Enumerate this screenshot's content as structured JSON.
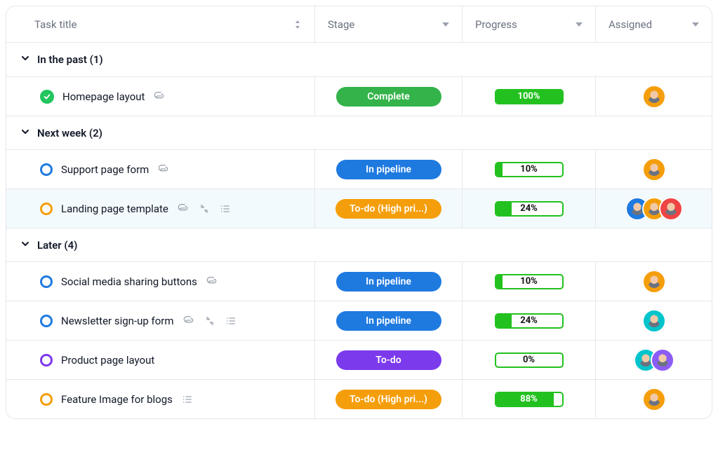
{
  "columns": {
    "title": "Task title",
    "stage": "Stage",
    "progress": "Progress",
    "assigned": "Assigned"
  },
  "groups": [
    {
      "label": "In the past (1)",
      "tasks": [
        {
          "status_type": "check",
          "status_color": "green",
          "name": "Homepage layout",
          "icons": [
            "attachment"
          ],
          "stage_label": "Complete",
          "stage_color": "green",
          "progress_pct": 100,
          "progress_text": "100%",
          "avatars": [
            {
              "bg": "orange"
            }
          ],
          "highlight": false
        }
      ]
    },
    {
      "label": "Next week (2)",
      "tasks": [
        {
          "status_type": "circle",
          "status_color": "blue",
          "name": "Support page form",
          "icons": [
            "attachment"
          ],
          "stage_label": "In pipeline",
          "stage_color": "blue",
          "progress_pct": 10,
          "progress_text": "10%",
          "avatars": [
            {
              "bg": "orange"
            }
          ],
          "highlight": false
        },
        {
          "status_type": "circle",
          "status_color": "orange",
          "name": "Landing page template",
          "icons": [
            "attachment",
            "subtask",
            "list"
          ],
          "stage_label": "To-do (High pri...)",
          "stage_color": "orange",
          "progress_pct": 24,
          "progress_text": "24%",
          "avatars": [
            {
              "bg": "blue"
            },
            {
              "bg": "orange"
            },
            {
              "bg": "red"
            }
          ],
          "highlight": true
        }
      ]
    },
    {
      "label": "Later (4)",
      "tasks": [
        {
          "status_type": "circle",
          "status_color": "blue",
          "name": "Social media sharing buttons",
          "icons": [
            "attachment"
          ],
          "stage_label": "In pipeline",
          "stage_color": "blue",
          "progress_pct": 10,
          "progress_text": "10%",
          "avatars": [
            {
              "bg": "orange"
            }
          ],
          "highlight": false
        },
        {
          "status_type": "circle",
          "status_color": "blue",
          "name": "Newsletter sign-up form",
          "icons": [
            "attachment",
            "subtask",
            "list"
          ],
          "stage_label": "In pipeline",
          "stage_color": "blue",
          "progress_pct": 24,
          "progress_text": "24%",
          "avatars": [
            {
              "bg": "teal"
            }
          ],
          "highlight": false
        },
        {
          "status_type": "circle",
          "status_color": "purple",
          "name": "Product page layout",
          "icons": [],
          "stage_label": "To-do",
          "stage_color": "purple",
          "progress_pct": 0,
          "progress_text": "0%",
          "avatars": [
            {
              "bg": "teal"
            },
            {
              "bg": "purple"
            }
          ],
          "highlight": false
        },
        {
          "status_type": "circle",
          "status_color": "orange",
          "name": "Feature Image for blogs",
          "icons": [
            "list"
          ],
          "stage_label": "To-do (High pri...)",
          "stage_color": "orange",
          "progress_pct": 88,
          "progress_text": "88%",
          "avatars": [
            {
              "bg": "orange"
            }
          ],
          "highlight": false
        }
      ]
    }
  ]
}
